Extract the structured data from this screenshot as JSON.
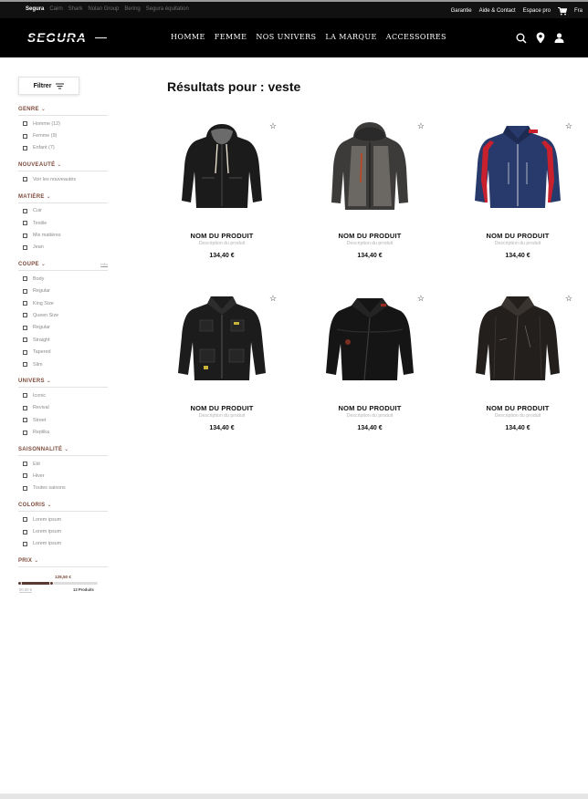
{
  "topbar": {
    "brands": [
      {
        "label": "Segura",
        "active": true
      },
      {
        "label": "Cairn",
        "active": false
      },
      {
        "label": "Shark",
        "active": false
      },
      {
        "label": "Nolan Group",
        "active": false
      },
      {
        "label": "Bering",
        "active": false
      },
      {
        "label": "Segura équitation",
        "active": false
      }
    ],
    "links": [
      "Garantie",
      "Aide & Contact",
      "Espace pro"
    ],
    "language": "Fra"
  },
  "header": {
    "logo_text": "SEGURA",
    "nav": [
      "HOMME",
      "FEMME",
      "NOS UNIVERS",
      "LA MARQUE",
      "ACCESSOIRES"
    ],
    "icons": [
      "search-icon",
      "location-pin-icon",
      "user-icon"
    ]
  },
  "sidebar": {
    "filter_label": "Filtrer",
    "groups": [
      {
        "title": "GENRE",
        "extra": "",
        "items": [
          "Homme (12)",
          "Femme (9)",
          "Enfant (7)"
        ]
      },
      {
        "title": "NOUVEAUTÉ",
        "extra": "",
        "items": [
          "Voir les nouveautés"
        ]
      },
      {
        "title": "MATIÈRE",
        "extra": "",
        "items": [
          "Cuir",
          "Textile",
          "Mix matières",
          "Jean"
        ]
      },
      {
        "title": "COUPE",
        "extra": "info",
        "items": [
          "Body",
          "Regular",
          "King Size",
          "Queen Size",
          "Regular",
          "Straight",
          "Tapered",
          "Slim"
        ]
      },
      {
        "title": "UNIVERS",
        "extra": "",
        "items": [
          "Iconic",
          "Revival",
          "Street",
          "Replika"
        ]
      },
      {
        "title": "SAISONNALITÉ",
        "extra": "",
        "items": [
          "Eté",
          "Hiver",
          "Toutes saisons"
        ]
      },
      {
        "title": "COLORIS",
        "extra": "",
        "items": [
          "Lorem ipsum",
          "Lorem ipsum",
          "Lorem ipsum"
        ]
      }
    ],
    "price": {
      "title": "PRIX",
      "current": "128,50 €",
      "min_label": "00,00 €",
      "count_label": "13 Produits",
      "level": 0.41
    }
  },
  "main": {
    "title": "Résultats pour : veste",
    "products": [
      {
        "name": "NOM DU PRODUIT",
        "description": "Description du produit",
        "price": "134,40 €",
        "image": "black-hooded-jacket"
      },
      {
        "name": "NOM DU PRODUIT",
        "description": "Description du produit",
        "price": "134,40 €",
        "image": "grey-hooded-jacket"
      },
      {
        "name": "NOM DU PRODUIT",
        "description": "Description du produit",
        "price": "134,40 €",
        "image": "navy-red-jacket"
      },
      {
        "name": "NOM DU PRODUIT",
        "description": "Description du produit",
        "price": "134,40 €",
        "image": "black-cargo-jacket"
      },
      {
        "name": "NOM DU PRODUIT",
        "description": "Description du produit",
        "price": "134,40 €",
        "image": "black-textile-jacket"
      },
      {
        "name": "NOM DU PRODUIT",
        "description": "Description du produit",
        "price": "134,40 €",
        "image": "black-leather-jacket"
      }
    ]
  },
  "colors": {
    "header_bg": "#000000",
    "accent": "#7c4b3b",
    "price_fill": "#5a3a30",
    "muted_text": "#8a8a8a"
  }
}
